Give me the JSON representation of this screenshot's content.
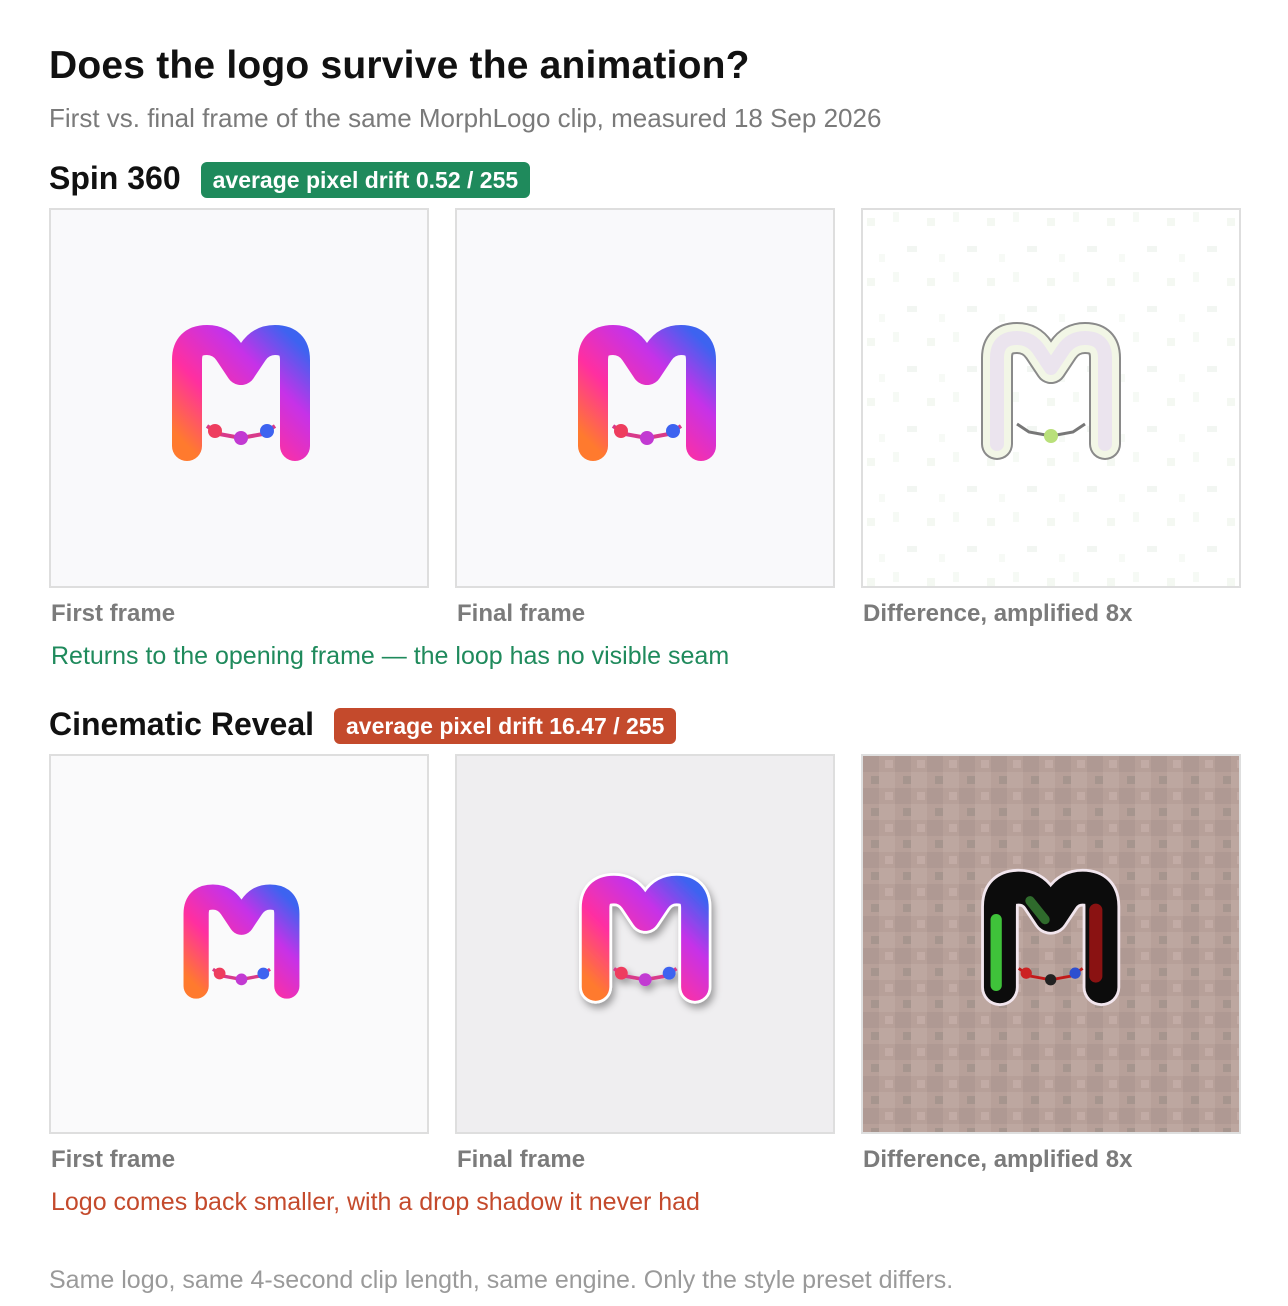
{
  "header": {
    "title": "Does the logo survive the animation?",
    "subtitle": "First vs. final frame of the same MorphLogo clip, measured 18 Sep 2026"
  },
  "colors": {
    "good": "#1f8a5c",
    "bad": "#c44a2c",
    "caption": "#7b7b7b"
  },
  "sections": [
    {
      "name": "Spin 360",
      "badge": "average pixel drift 0.52 / 255",
      "badge_color": "#1f8a5c",
      "captions": [
        "First frame",
        "Final frame",
        "Difference, amplified 8x"
      ],
      "verdict": "Returns to the opening frame — the loop has no visible seam",
      "verdict_color": "#1f8a5c"
    },
    {
      "name": "Cinematic Reveal",
      "badge": "average pixel drift 16.47 / 255",
      "badge_color": "#c44a2c",
      "captions": [
        "First frame",
        "Final frame",
        "Difference, amplified 8x"
      ],
      "verdict": "Logo comes back smaller, with a drop shadow it never had",
      "verdict_color": "#c44a2c"
    }
  ],
  "footer": "Same logo, same 4-second clip length, same engine. Only the style preset differs."
}
